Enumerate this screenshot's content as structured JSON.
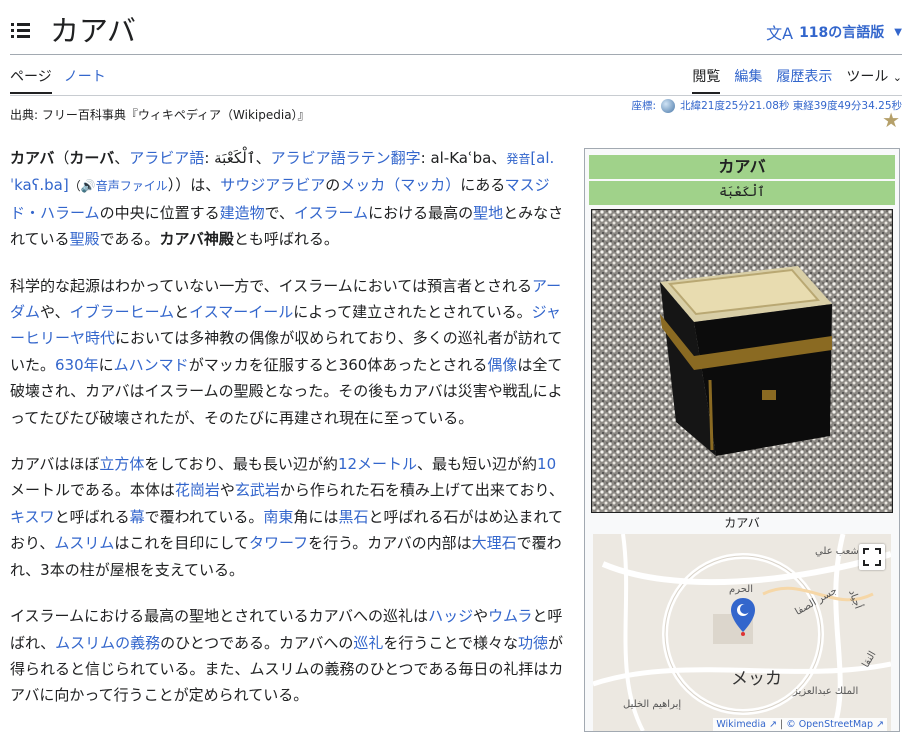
{
  "header": {
    "title": "カアバ",
    "languages_label": "118の言語版"
  },
  "tabs": {
    "page": "ページ",
    "talk": "ノート",
    "read": "閲覧",
    "edit": "編集",
    "history": "履歴表示",
    "tools": "ツール"
  },
  "source": "出典: フリー百科事典『ウィキペディア（Wikipedia）』",
  "coordinates": {
    "label": "座標:",
    "value": "北緯21度25分21.08秒 東経39度49分34.25秒"
  },
  "infobox": {
    "title": "カアバ",
    "arabic": "ٱلْكَعْبَة",
    "caption": "カアバ",
    "map_city": "メッカ",
    "map_label_haram": "الحرم",
    "map_label_1": "شعب علي",
    "map_label_2": "جسر الصفا",
    "map_label_3": "إبراهيم الخليل",
    "map_label_4": "الملك عبدالعزيز",
    "map_label_5": "أجياد",
    "map_label_6": "النقا",
    "map_credit_1": "Wikimedia",
    "map_credit_2": "© OpenStreetMap"
  },
  "article": {
    "p1": {
      "t1": "カアバ",
      "t2": "（",
      "t3": "カーバ",
      "t4": "、",
      "t5": "アラビア語",
      "t6": ": ٱلْكَعْبَة、",
      "t7": "アラビア語ラテン翻字",
      "t8": ": al-Kaʿba、",
      "t9": "発音",
      "t10": "[al.ˈkaʕ.ba]",
      "t11": "（🔊",
      "t12": "音声ファイル",
      "t13": "））は、",
      "t14": "サウジアラビア",
      "t15": "の",
      "t16": "メッカ（マッカ）",
      "t17": "にある",
      "t18": "マスジド・ハラーム",
      "t19": "の中央に位置する",
      "t20": "建造物",
      "t21": "で、",
      "t22": "イスラーム",
      "t23": "における最高の",
      "t24": "聖地",
      "t25": "とみなされている",
      "t26": "聖殿",
      "t27": "である。",
      "t28": "カアバ神殿",
      "t29": "とも呼ばれる。"
    },
    "p2": {
      "t1": "科学的な起源はわかっていない一方で、イスラームにおいては預言者とされる",
      "t2": "アーダム",
      "t3": "や、",
      "t4": "イブラーヒーム",
      "t5": "と",
      "t6": "イスマーイール",
      "t7": "によって建立されたとされている。",
      "t8": "ジャーヒリーヤ時代",
      "t9": "においては多神教の偶像が収められており、多くの巡礼者が訪れていた。",
      "t10": "630年",
      "t11": "に",
      "t12": "ムハンマド",
      "t13": "がマッカを征服すると360体あったとされる",
      "t14": "偶像",
      "t15": "は全て破壊され、カアバはイスラームの聖殿となった。その後もカアバは災害や戦乱によってたびたび破壊されたが、そのたびに再建され現在に至っている。"
    },
    "p3": {
      "t1": "カアバはほぼ",
      "t2": "立方体",
      "t3": "をしており、最も長い辺が約",
      "t4": "12メートル",
      "t5": "、最も短い辺が約",
      "t6": "10",
      "t7": "メートルである。本体は",
      "t8": "花崗岩",
      "t9": "や",
      "t10": "玄武岩",
      "t11": "から作られた石を積み上げて出来ており、",
      "t12": "キスワ",
      "t13": "と呼ばれる",
      "t14": "幕",
      "t15": "で覆われている。",
      "t16": "南東",
      "t17": "角には",
      "t18": "黒石",
      "t19": "と呼ばれる石がはめ込まれており、",
      "t20": "ムスリム",
      "t21": "はこれを目印にして",
      "t22": "タワーフ",
      "t23": "を行う。カアバの内部は",
      "t24": "大理石",
      "t25": "で覆われ、3本の柱が屋根を支えている。"
    },
    "p4": {
      "t1": "イスラームにおける最高の聖地とされているカアバへの巡礼は",
      "t2": "ハッジ",
      "t3": "や",
      "t4": "ウムラ",
      "t5": "と呼ばれ、",
      "t6": "ムスリムの義務",
      "t7": "のひとつである。カアバへの",
      "t8": "巡礼",
      "t9": "を行うことで様々な",
      "t10": "功徳",
      "t11": "が得られると信じられている。また、ムスリムの義務のひとつである毎日の礼拝はカアバに向かって行うことが定められている。"
    }
  }
}
